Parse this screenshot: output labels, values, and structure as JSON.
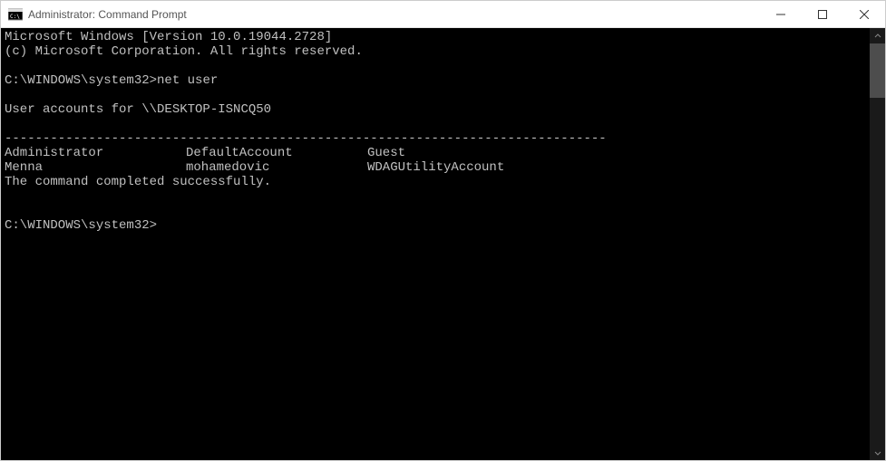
{
  "window": {
    "title": "Administrator: Command Prompt"
  },
  "terminal": {
    "header_line1": "Microsoft Windows [Version 10.0.19044.2728]",
    "header_line2": "(c) Microsoft Corporation. All rights reserved.",
    "prompt1_path": "C:\\WINDOWS\\system32>",
    "prompt1_command": "net user",
    "output_header": "User accounts for \\\\DESKTOP-ISNCQ50",
    "separator": "-------------------------------------------------------------------------------",
    "users_row1_col1": "Administrator",
    "users_row1_col2": "DefaultAccount",
    "users_row1_col3": "Guest",
    "users_row2_col1": "Menna",
    "users_row2_col2": "mohamedovic",
    "users_row2_col3": "WDAGUtilityAccount",
    "completion_msg": "The command completed successfully.",
    "prompt2_path": "C:\\WINDOWS\\system32>"
  }
}
